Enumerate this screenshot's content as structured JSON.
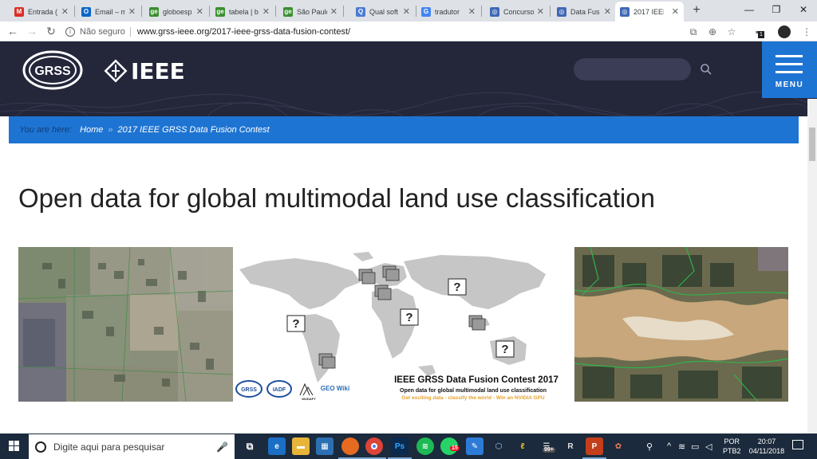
{
  "browser": {
    "tabs": [
      {
        "label": "Entrada (",
        "icon": "gmail-icon",
        "color": "#d93025",
        "glyph": "M"
      },
      {
        "label": "Email – m",
        "icon": "outlook-icon",
        "color": "#0a64c8",
        "glyph": "O"
      },
      {
        "label": "globoesp",
        "icon": "ge-icon",
        "color": "#3a8f2f",
        "glyph": "ge"
      },
      {
        "label": "tabela | b",
        "icon": "ge-icon",
        "color": "#3a8f2f",
        "glyph": "ge"
      },
      {
        "label": "São Paulo",
        "icon": "ge-icon",
        "color": "#3a8f2f",
        "glyph": "ge"
      },
      {
        "label": "Qual soft",
        "icon": "quora-icon",
        "color": "#4a7bd1",
        "glyph": "Q"
      },
      {
        "label": "tradutor",
        "icon": "google-icon",
        "color": "#4285f4",
        "glyph": "G"
      },
      {
        "label": "Concurso",
        "icon": "site-icon",
        "color": "#3f68b5",
        "glyph": "◎"
      },
      {
        "label": "Data Fus",
        "icon": "site-icon",
        "color": "#3f68b5",
        "glyph": "◎"
      },
      {
        "label": "2017 IEEE",
        "icon": "site-icon",
        "color": "#3f68b5",
        "glyph": "◎",
        "active": true
      }
    ],
    "address": {
      "security": "Não seguro",
      "url": "www.grss-ieee.org/2017-ieee-grss-data-fusion-contest/"
    },
    "ext_badge": "1"
  },
  "site": {
    "grss_logo_text": "GRSS",
    "ieee_logo_text": "IEEE",
    "menu_label": "MENU",
    "search_placeholder": "",
    "breadcrumb": {
      "prefix": "You are here:",
      "home": "Home",
      "separator": "»",
      "current": "2017 IEEE GRSS Data Fusion Contest"
    },
    "heading": "Open data for global multimodal land use classification",
    "banner": {
      "title": "IEEE GRSS Data Fusion Contest 2017",
      "subtitle": "Open data for global multimodal land use classification",
      "tagline": "Get exciting data - classify the world - Win an NVIDIA GPU",
      "question_mark": "?",
      "partner_logos": [
        "GRSS",
        "IADF",
        "WUDAPT",
        "GEO Wiki"
      ]
    }
  },
  "taskbar": {
    "search_placeholder": "Digite aqui para pesquisar",
    "language_line1": "POR",
    "language_line2": "PTB2",
    "time": "20:07",
    "date": "04/11/2018",
    "badges": {
      "whatsapp": "15",
      "app99": "99+"
    }
  }
}
